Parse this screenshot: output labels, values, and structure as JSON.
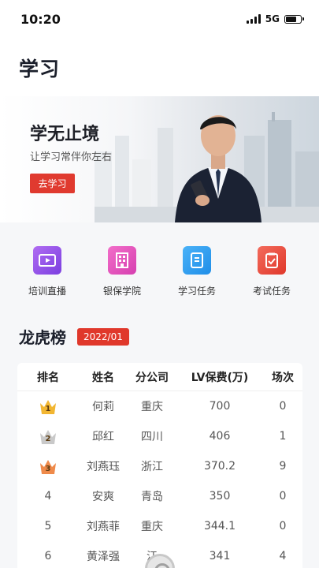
{
  "status_bar": {
    "time": "10:20",
    "network": "5G",
    "battery_level": 0.7
  },
  "page": {
    "title": "学习"
  },
  "banner": {
    "title": "学无止境",
    "subtitle": "让学习常伴你左右",
    "button_label": "去学习"
  },
  "features": [
    {
      "label": "培训直播",
      "icon": "live-play-icon",
      "color": "#8a4cf0"
    },
    {
      "label": "银保学院",
      "icon": "building-icon",
      "color": "#e24fbc"
    },
    {
      "label": "学习任务",
      "icon": "book-icon",
      "color": "#2a97ee"
    },
    {
      "label": "考试任务",
      "icon": "exam-check-icon",
      "color": "#e8443a"
    }
  ],
  "leaderboard": {
    "title": "龙虎榜",
    "period": "2022/01",
    "columns": [
      "排名",
      "姓名",
      "分公司",
      "LV保费(万)",
      "场次"
    ],
    "rows": [
      {
        "rank": "1",
        "name": "何莉",
        "branch": "重庆",
        "premium": "700",
        "sessions": "0",
        "medal": "gold"
      },
      {
        "rank": "2",
        "name": "邱红",
        "branch": "四川",
        "premium": "406",
        "sessions": "1",
        "medal": "silver"
      },
      {
        "rank": "3",
        "name": "刘燕珏",
        "branch": "浙江",
        "premium": "370.2",
        "sessions": "9",
        "medal": "bronze"
      },
      {
        "rank": "4",
        "name": "安爽",
        "branch": "青岛",
        "premium": "350",
        "sessions": "0"
      },
      {
        "rank": "5",
        "name": "刘燕菲",
        "branch": "重庆",
        "premium": "344.1",
        "sessions": "0"
      },
      {
        "rank": "6",
        "name": "黄泽强",
        "branch": "江",
        "premium": "341",
        "sessions": "4"
      }
    ]
  },
  "colors": {
    "accent": "#e0382b",
    "gold": "#f2b632",
    "silver": "#c9c9c9",
    "bronze": "#ef8a4a"
  }
}
